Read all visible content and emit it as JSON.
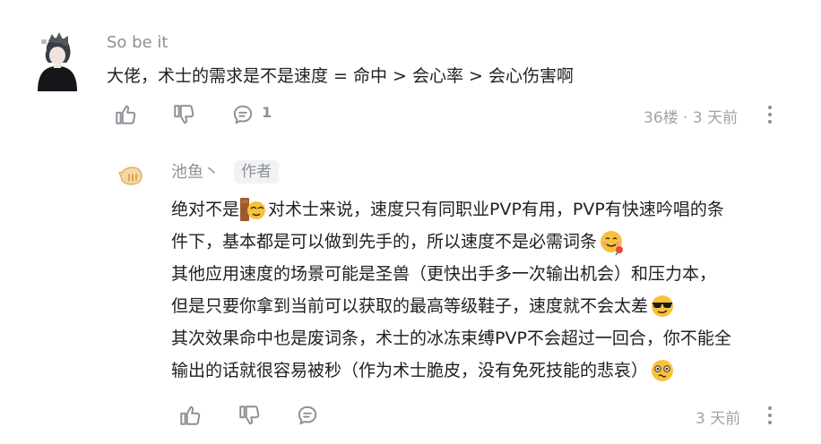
{
  "comment": {
    "username": "So be it",
    "text": "大佬，术士的需求是不是速度 = 命中 > 会心率 > 会心伤害啊",
    "reply_count": "1",
    "meta": "36楼 · 3 天前",
    "icons": {
      "like": "thumbs-up-icon",
      "dislike": "thumbs-down-icon",
      "reply": "chat-bubble-icon",
      "more": "more-vertical-icon"
    }
  },
  "reply": {
    "username": "池鱼丶",
    "badge": "作者",
    "lines": {
      "l1a": "绝对不是",
      "l1b": "对术士来说，速度只有同职业PVP有用，PVP有快速吟唱的条",
      "l2": "件下，基本都是可以做到先手的，所以速度不是必需词条",
      "l3": "其他应用速度的场景可能是圣兽（更快出手多一次输出机会）和压力本，",
      "l4": "但是只要你拿到当前可以获取的最高等级鞋子，速度就不会太差",
      "l5": "其次效果命中也是废词条，术士的冰冻束缚PVP不会超过一回合，你不能全",
      "l6": "输出的话就很容易被秒（作为术士脆皮，没有免死技能的悲哀）"
    },
    "emojis": [
      "hiding-face-emoji",
      "flower-smile-emoji",
      "sunglasses-emoji",
      "woozy-face-emoji"
    ],
    "meta": "3 天前"
  }
}
